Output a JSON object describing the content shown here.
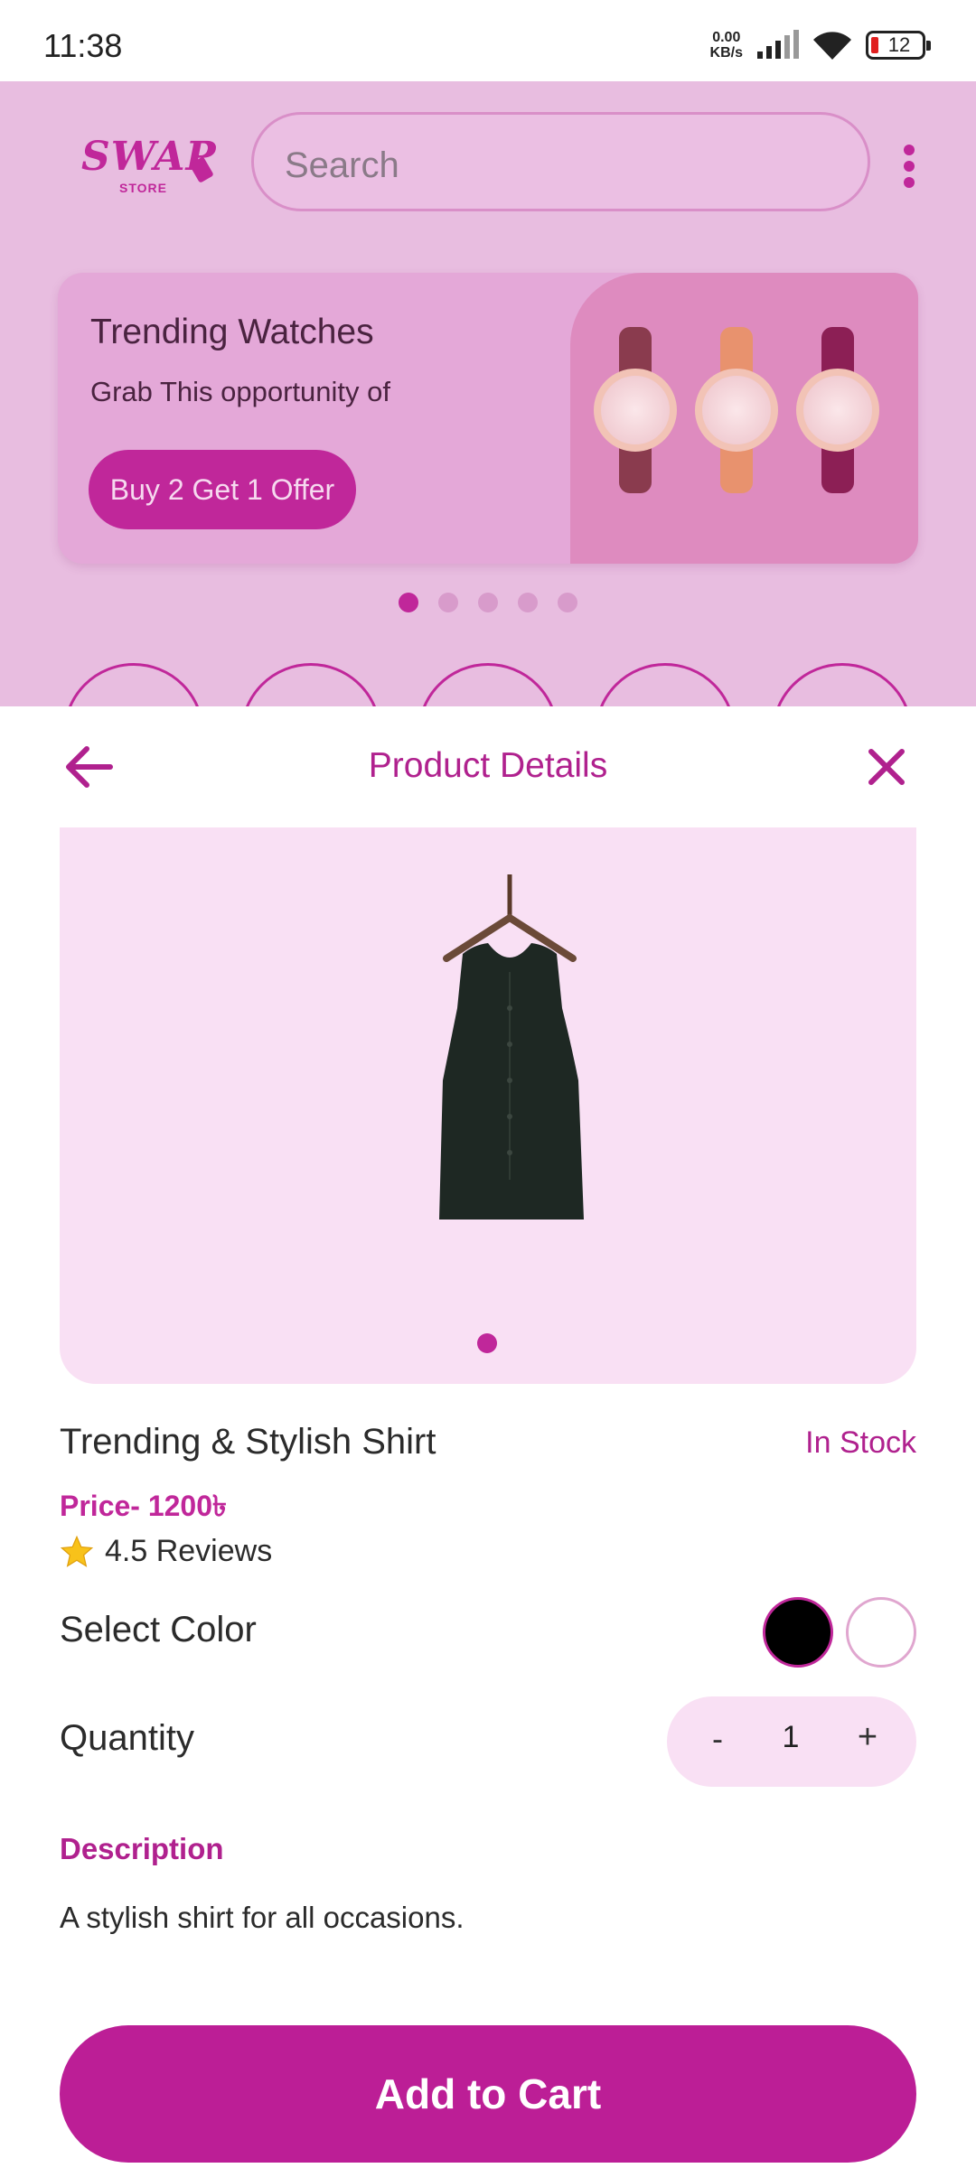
{
  "status_bar": {
    "time": "11:38",
    "net_speed_value": "0.00",
    "net_speed_unit": "KB/s",
    "battery": "12"
  },
  "home": {
    "logo_text": "SWAP",
    "logo_sub": "STORE",
    "search_placeholder": "Search",
    "banner": {
      "title": "Trending Watches",
      "subtitle": "Grab This opportunity of",
      "button_label": "Buy 2 Get 1 Offer"
    },
    "carousel_dots": 5,
    "carousel_active_index": 0
  },
  "sheet": {
    "title": "Product Details",
    "back_icon": "arrow-left-icon",
    "close_icon": "close-icon",
    "product": {
      "name": "Trending & Stylish Shirt",
      "stock_status": "In Stock",
      "price": "Price- 1200৳",
      "rating": "4.5 Reviews",
      "image_dots": 1
    },
    "color": {
      "label": "Select Color",
      "options": [
        "#000000",
        "#ffffff"
      ],
      "selected_index": 0
    },
    "quantity": {
      "label": "Quantity",
      "minus": "-",
      "value": "1",
      "plus": "+"
    },
    "description": {
      "title": "Description",
      "text": "A stylish shirt for all occasions."
    },
    "add_to_cart_label": "Add to Cart"
  },
  "colors": {
    "accent": "#bc1e96",
    "background_pink": "#e8bde0",
    "light_pink": "#f9e0f4"
  }
}
